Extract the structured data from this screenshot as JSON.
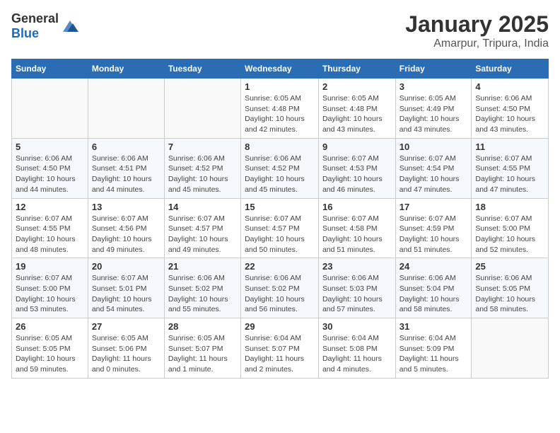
{
  "header": {
    "logo_general": "General",
    "logo_blue": "Blue",
    "month_title": "January 2025",
    "location": "Amarpur, Tripura, India"
  },
  "weekdays": [
    "Sunday",
    "Monday",
    "Tuesday",
    "Wednesday",
    "Thursday",
    "Friday",
    "Saturday"
  ],
  "weeks": [
    [
      {
        "day": "",
        "info": ""
      },
      {
        "day": "",
        "info": ""
      },
      {
        "day": "",
        "info": ""
      },
      {
        "day": "1",
        "info": "Sunrise: 6:05 AM\nSunset: 4:48 PM\nDaylight: 10 hours\nand 42 minutes."
      },
      {
        "day": "2",
        "info": "Sunrise: 6:05 AM\nSunset: 4:48 PM\nDaylight: 10 hours\nand 43 minutes."
      },
      {
        "day": "3",
        "info": "Sunrise: 6:05 AM\nSunset: 4:49 PM\nDaylight: 10 hours\nand 43 minutes."
      },
      {
        "day": "4",
        "info": "Sunrise: 6:06 AM\nSunset: 4:50 PM\nDaylight: 10 hours\nand 43 minutes."
      }
    ],
    [
      {
        "day": "5",
        "info": "Sunrise: 6:06 AM\nSunset: 4:50 PM\nDaylight: 10 hours\nand 44 minutes."
      },
      {
        "day": "6",
        "info": "Sunrise: 6:06 AM\nSunset: 4:51 PM\nDaylight: 10 hours\nand 44 minutes."
      },
      {
        "day": "7",
        "info": "Sunrise: 6:06 AM\nSunset: 4:52 PM\nDaylight: 10 hours\nand 45 minutes."
      },
      {
        "day": "8",
        "info": "Sunrise: 6:06 AM\nSunset: 4:52 PM\nDaylight: 10 hours\nand 45 minutes."
      },
      {
        "day": "9",
        "info": "Sunrise: 6:07 AM\nSunset: 4:53 PM\nDaylight: 10 hours\nand 46 minutes."
      },
      {
        "day": "10",
        "info": "Sunrise: 6:07 AM\nSunset: 4:54 PM\nDaylight: 10 hours\nand 47 minutes."
      },
      {
        "day": "11",
        "info": "Sunrise: 6:07 AM\nSunset: 4:55 PM\nDaylight: 10 hours\nand 47 minutes."
      }
    ],
    [
      {
        "day": "12",
        "info": "Sunrise: 6:07 AM\nSunset: 4:55 PM\nDaylight: 10 hours\nand 48 minutes."
      },
      {
        "day": "13",
        "info": "Sunrise: 6:07 AM\nSunset: 4:56 PM\nDaylight: 10 hours\nand 49 minutes."
      },
      {
        "day": "14",
        "info": "Sunrise: 6:07 AM\nSunset: 4:57 PM\nDaylight: 10 hours\nand 49 minutes."
      },
      {
        "day": "15",
        "info": "Sunrise: 6:07 AM\nSunset: 4:57 PM\nDaylight: 10 hours\nand 50 minutes."
      },
      {
        "day": "16",
        "info": "Sunrise: 6:07 AM\nSunset: 4:58 PM\nDaylight: 10 hours\nand 51 minutes."
      },
      {
        "day": "17",
        "info": "Sunrise: 6:07 AM\nSunset: 4:59 PM\nDaylight: 10 hours\nand 51 minutes."
      },
      {
        "day": "18",
        "info": "Sunrise: 6:07 AM\nSunset: 5:00 PM\nDaylight: 10 hours\nand 52 minutes."
      }
    ],
    [
      {
        "day": "19",
        "info": "Sunrise: 6:07 AM\nSunset: 5:00 PM\nDaylight: 10 hours\nand 53 minutes."
      },
      {
        "day": "20",
        "info": "Sunrise: 6:07 AM\nSunset: 5:01 PM\nDaylight: 10 hours\nand 54 minutes."
      },
      {
        "day": "21",
        "info": "Sunrise: 6:06 AM\nSunset: 5:02 PM\nDaylight: 10 hours\nand 55 minutes."
      },
      {
        "day": "22",
        "info": "Sunrise: 6:06 AM\nSunset: 5:02 PM\nDaylight: 10 hours\nand 56 minutes."
      },
      {
        "day": "23",
        "info": "Sunrise: 6:06 AM\nSunset: 5:03 PM\nDaylight: 10 hours\nand 57 minutes."
      },
      {
        "day": "24",
        "info": "Sunrise: 6:06 AM\nSunset: 5:04 PM\nDaylight: 10 hours\nand 58 minutes."
      },
      {
        "day": "25",
        "info": "Sunrise: 6:06 AM\nSunset: 5:05 PM\nDaylight: 10 hours\nand 58 minutes."
      }
    ],
    [
      {
        "day": "26",
        "info": "Sunrise: 6:05 AM\nSunset: 5:05 PM\nDaylight: 10 hours\nand 59 minutes."
      },
      {
        "day": "27",
        "info": "Sunrise: 6:05 AM\nSunset: 5:06 PM\nDaylight: 11 hours\nand 0 minutes."
      },
      {
        "day": "28",
        "info": "Sunrise: 6:05 AM\nSunset: 5:07 PM\nDaylight: 11 hours\nand 1 minute."
      },
      {
        "day": "29",
        "info": "Sunrise: 6:04 AM\nSunset: 5:07 PM\nDaylight: 11 hours\nand 2 minutes."
      },
      {
        "day": "30",
        "info": "Sunrise: 6:04 AM\nSunset: 5:08 PM\nDaylight: 11 hours\nand 4 minutes."
      },
      {
        "day": "31",
        "info": "Sunrise: 6:04 AM\nSunset: 5:09 PM\nDaylight: 11 hours\nand 5 minutes."
      },
      {
        "day": "",
        "info": ""
      }
    ]
  ]
}
